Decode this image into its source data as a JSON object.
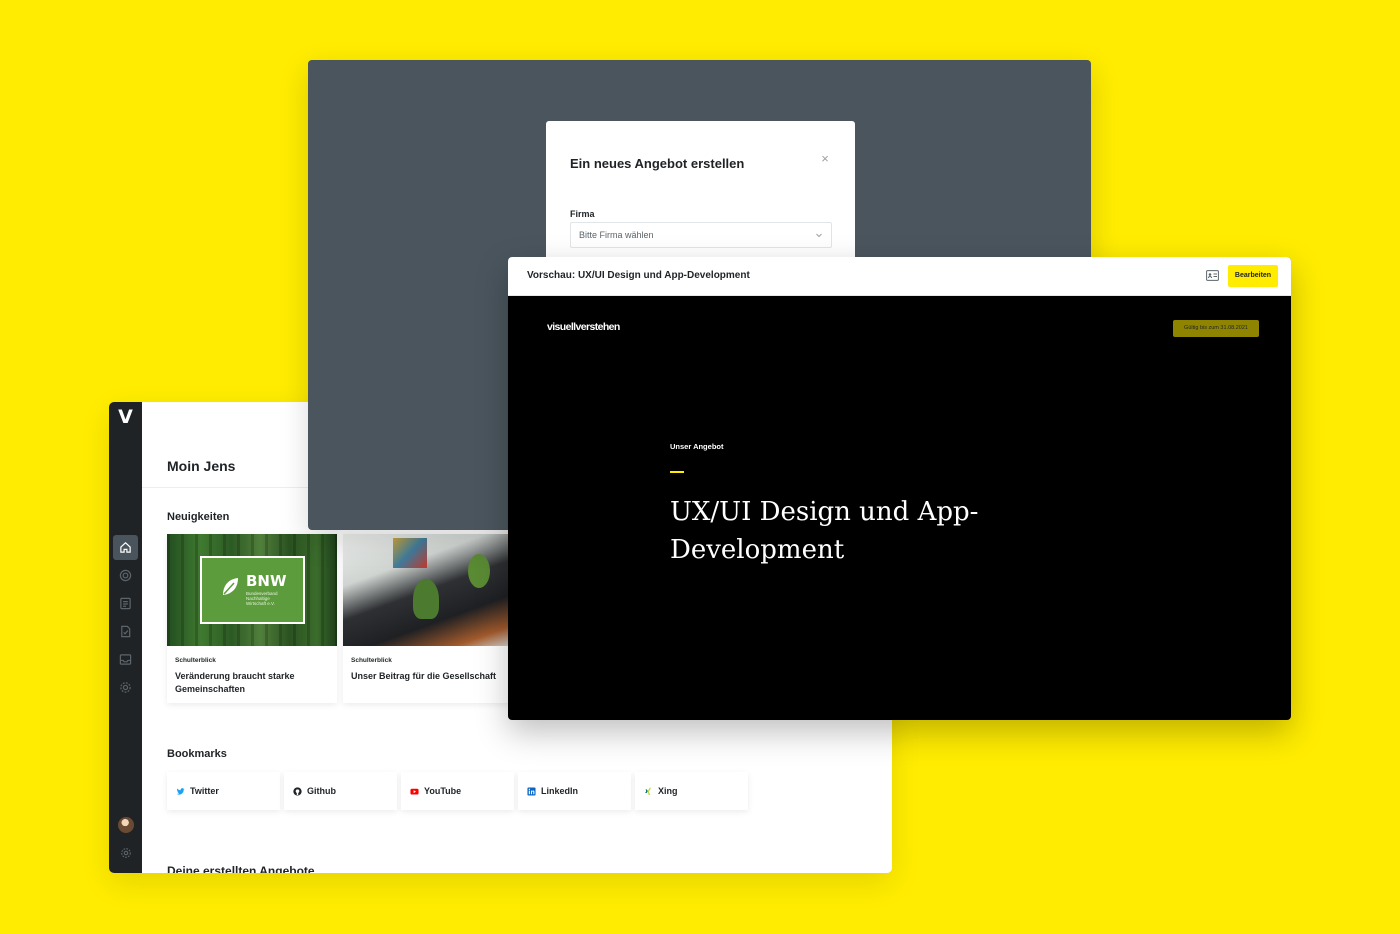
{
  "colors": {
    "background": "#FFEC00",
    "rail": "#1F2326",
    "overlay": "#4A555D",
    "accent": "#FFEC00",
    "badge": "#8F8400"
  },
  "dashboard": {
    "logo": "V",
    "greeting": "Moin Jens",
    "news_title": "Neuigkeiten",
    "news": [
      {
        "category": "Schulterblick",
        "headline": "Veränderung braucht starke Gemeinschaften",
        "logo_text": "BNW",
        "logo_subtext": "Bundesverband Nachhaltige Wirtschaft e.V."
      },
      {
        "category": "Schulterblick",
        "headline": "Unser Beitrag für die Gesellschaft"
      }
    ],
    "bookmarks_title": "Bookmarks",
    "bookmarks": [
      {
        "label": "Twitter",
        "icon": "twitter-icon"
      },
      {
        "label": "Github",
        "icon": "github-icon"
      },
      {
        "label": "YouTube",
        "icon": "youtube-icon"
      },
      {
        "label": "LinkedIn",
        "icon": "linkedin-icon"
      },
      {
        "label": "Xing",
        "icon": "xing-icon"
      }
    ],
    "created_title": "Deine erstellten Angebote",
    "rail_icons": [
      "home-icon",
      "target-icon",
      "document-list-icon",
      "file-check-icon",
      "inbox-icon",
      "gear-cog-icon"
    ]
  },
  "modal": {
    "title": "Ein neues Angebot erstellen",
    "close": "×",
    "field_label": "Firma",
    "field_placeholder": "Bitte Firma wählen"
  },
  "preview": {
    "title": "Vorschau: UX/UI Design und App-Development",
    "edit_label": "Bearbeiten",
    "brand": "visuellverstehen",
    "valid_badge": "Gültig bis zum 31.08.2021",
    "kicker": "Unser Angebot",
    "headline": "UX/UI Design und App-Development"
  }
}
